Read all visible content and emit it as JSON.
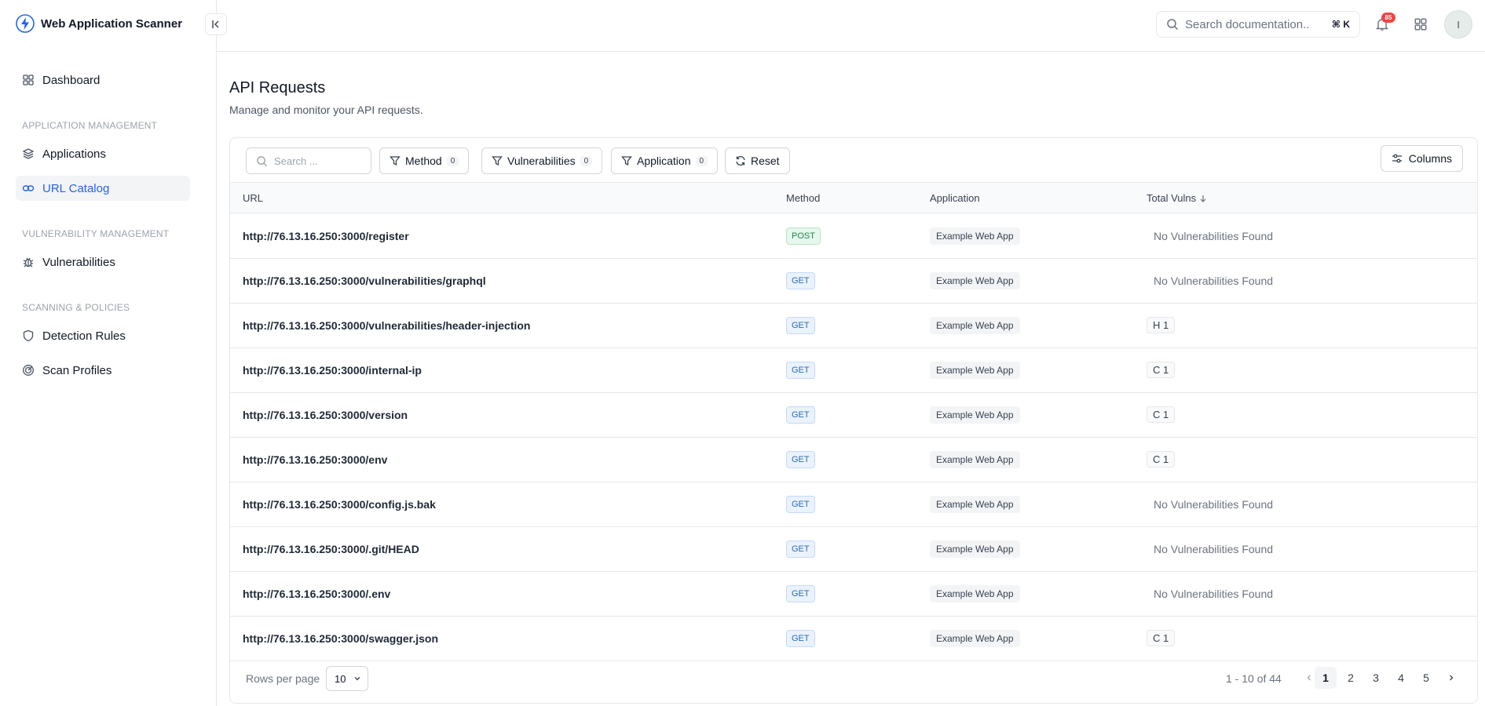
{
  "app": {
    "title": "Web Application Scanner"
  },
  "sidebar": {
    "dashboard": "Dashboard",
    "sections": [
      {
        "label": "APPLICATION MANAGEMENT",
        "items": [
          "Applications",
          "URL Catalog"
        ]
      },
      {
        "label": "VULNERABILITY MANAGEMENT",
        "items": [
          "Vulnerabilities"
        ]
      },
      {
        "label": "SCANNING & POLICIES",
        "items": [
          "Detection Rules",
          "Scan Profiles"
        ]
      }
    ],
    "active_item": "URL Catalog"
  },
  "topbar": {
    "search_placeholder": "Search documentation...",
    "shortcut": "⌘ K",
    "notification_count": "85",
    "avatar_initial": "I"
  },
  "page": {
    "title": "API Requests",
    "subtitle": "Manage and monitor your API requests."
  },
  "toolbar": {
    "search_placeholder": "Search ...",
    "filters": [
      {
        "label": "Method",
        "count": "0"
      },
      {
        "label": "Vulnerabilities",
        "count": "0"
      },
      {
        "label": "Application",
        "count": "0"
      }
    ],
    "reset_label": "Reset",
    "columns_label": "Columns"
  },
  "table": {
    "headers": [
      "URL",
      "Method",
      "Application",
      "Total Vulns"
    ],
    "rows": [
      {
        "url": "http://76.13.16.250:3000/register",
        "method": "POST",
        "application": "Example Web App",
        "vulns": "No Vulnerabilities Found"
      },
      {
        "url": "http://76.13.16.250:3000/vulnerabilities/graphql",
        "method": "GET",
        "application": "Example Web App",
        "vulns": "No Vulnerabilities Found"
      },
      {
        "url": "http://76.13.16.250:3000/vulnerabilities/header-injection",
        "method": "GET",
        "application": "Example Web App",
        "vulns": "H 1"
      },
      {
        "url": "http://76.13.16.250:3000/internal-ip",
        "method": "GET",
        "application": "Example Web App",
        "vulns": "C 1"
      },
      {
        "url": "http://76.13.16.250:3000/version",
        "method": "GET",
        "application": "Example Web App",
        "vulns": "C 1"
      },
      {
        "url": "http://76.13.16.250:3000/env",
        "method": "GET",
        "application": "Example Web App",
        "vulns": "C 1"
      },
      {
        "url": "http://76.13.16.250:3000/config.js.bak",
        "method": "GET",
        "application": "Example Web App",
        "vulns": "No Vulnerabilities Found"
      },
      {
        "url": "http://76.13.16.250:3000/.git/HEAD",
        "method": "GET",
        "application": "Example Web App",
        "vulns": "No Vulnerabilities Found"
      },
      {
        "url": "http://76.13.16.250:3000/.env",
        "method": "GET",
        "application": "Example Web App",
        "vulns": "No Vulnerabilities Found"
      },
      {
        "url": "http://76.13.16.250:3000/swagger.json",
        "method": "GET",
        "application": "Example Web App",
        "vulns": "C 1"
      }
    ]
  },
  "pagination": {
    "rows_per_page_label": "Rows per page",
    "rows_per_page": "10",
    "range": "1 - 10 of 44",
    "pages": [
      "1",
      "2",
      "3",
      "4",
      "5"
    ],
    "current_page": "1"
  },
  "colors": {
    "accent": "#2563eb",
    "badge": "#ef4444"
  }
}
